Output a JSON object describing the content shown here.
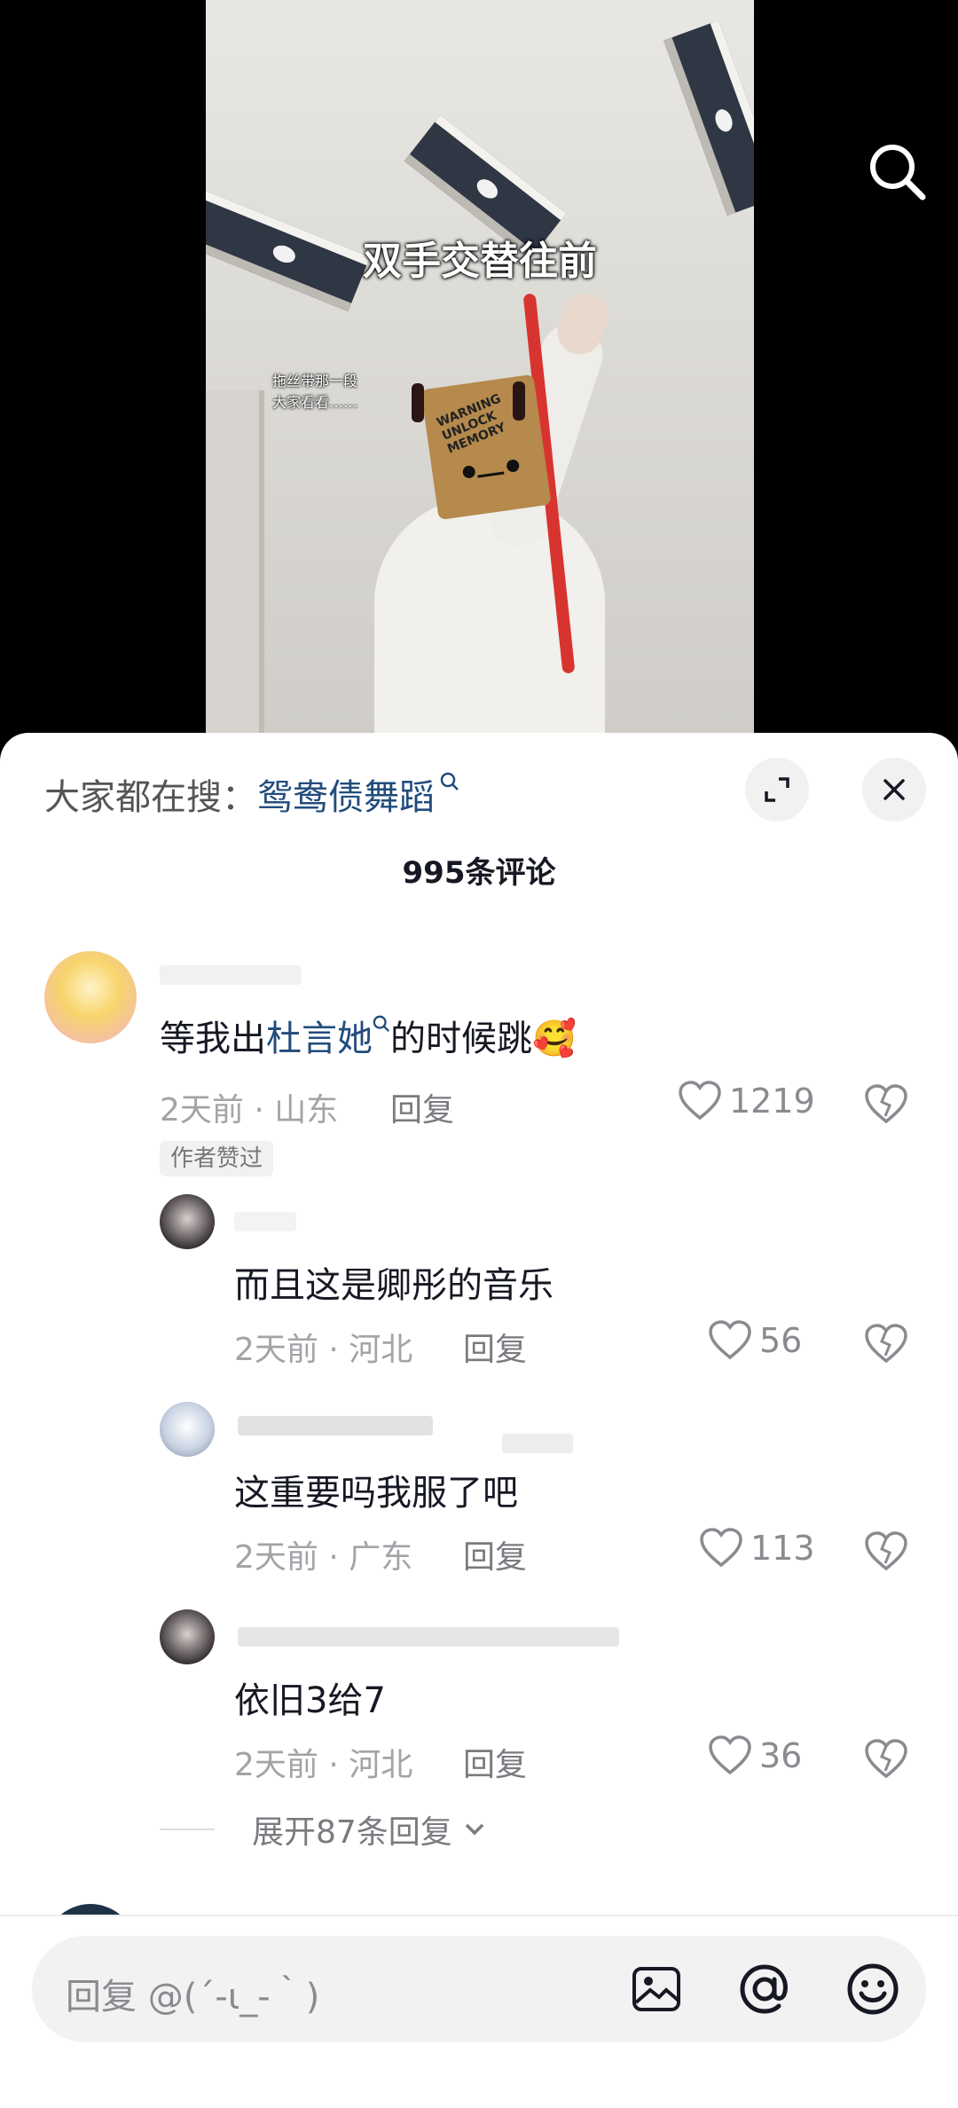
{
  "video": {
    "caption": "双手交替往前",
    "small_text_line1": "拖丝带那一段",
    "small_text_line2": "大家看看……",
    "bag_text": "WARNING UNLOCK MEMORY"
  },
  "sheet": {
    "hot_search_prefix": "大家都在搜：",
    "hot_search_keyword": "鸳鸯债舞蹈",
    "comment_count": "995条评论"
  },
  "comments": [
    {
      "text_before": "等我出",
      "text_keyword": "杜言她",
      "text_after": "的时候跳🥰",
      "meta": "2天前 · 山东",
      "reply": "回复",
      "likes": "1219",
      "badge": "作者赞过"
    },
    {
      "text": "而且这是卿彤的音乐",
      "meta": "2天前 · 河北",
      "reply": "回复",
      "likes": "56"
    },
    {
      "text": "这重要吗我服了吧",
      "meta": "2天前 · 广东",
      "reply": "回复",
      "likes": "113"
    },
    {
      "text": "依旧3给7",
      "meta": "2天前 · 河北",
      "reply": "回复",
      "likes": "36"
    }
  ],
  "expand_replies": "展开87条回复",
  "input": {
    "placeholder": "回复 @(´-ι_-｀)"
  },
  "icons": {
    "search": "search-icon",
    "collapse": "collapse-icon",
    "close": "close-icon",
    "heart": "heart-icon",
    "dislike": "broken-heart-icon",
    "image": "image-icon",
    "at": "at-icon",
    "emoji": "emoji-icon",
    "chevron": "chevron-down-icon"
  }
}
